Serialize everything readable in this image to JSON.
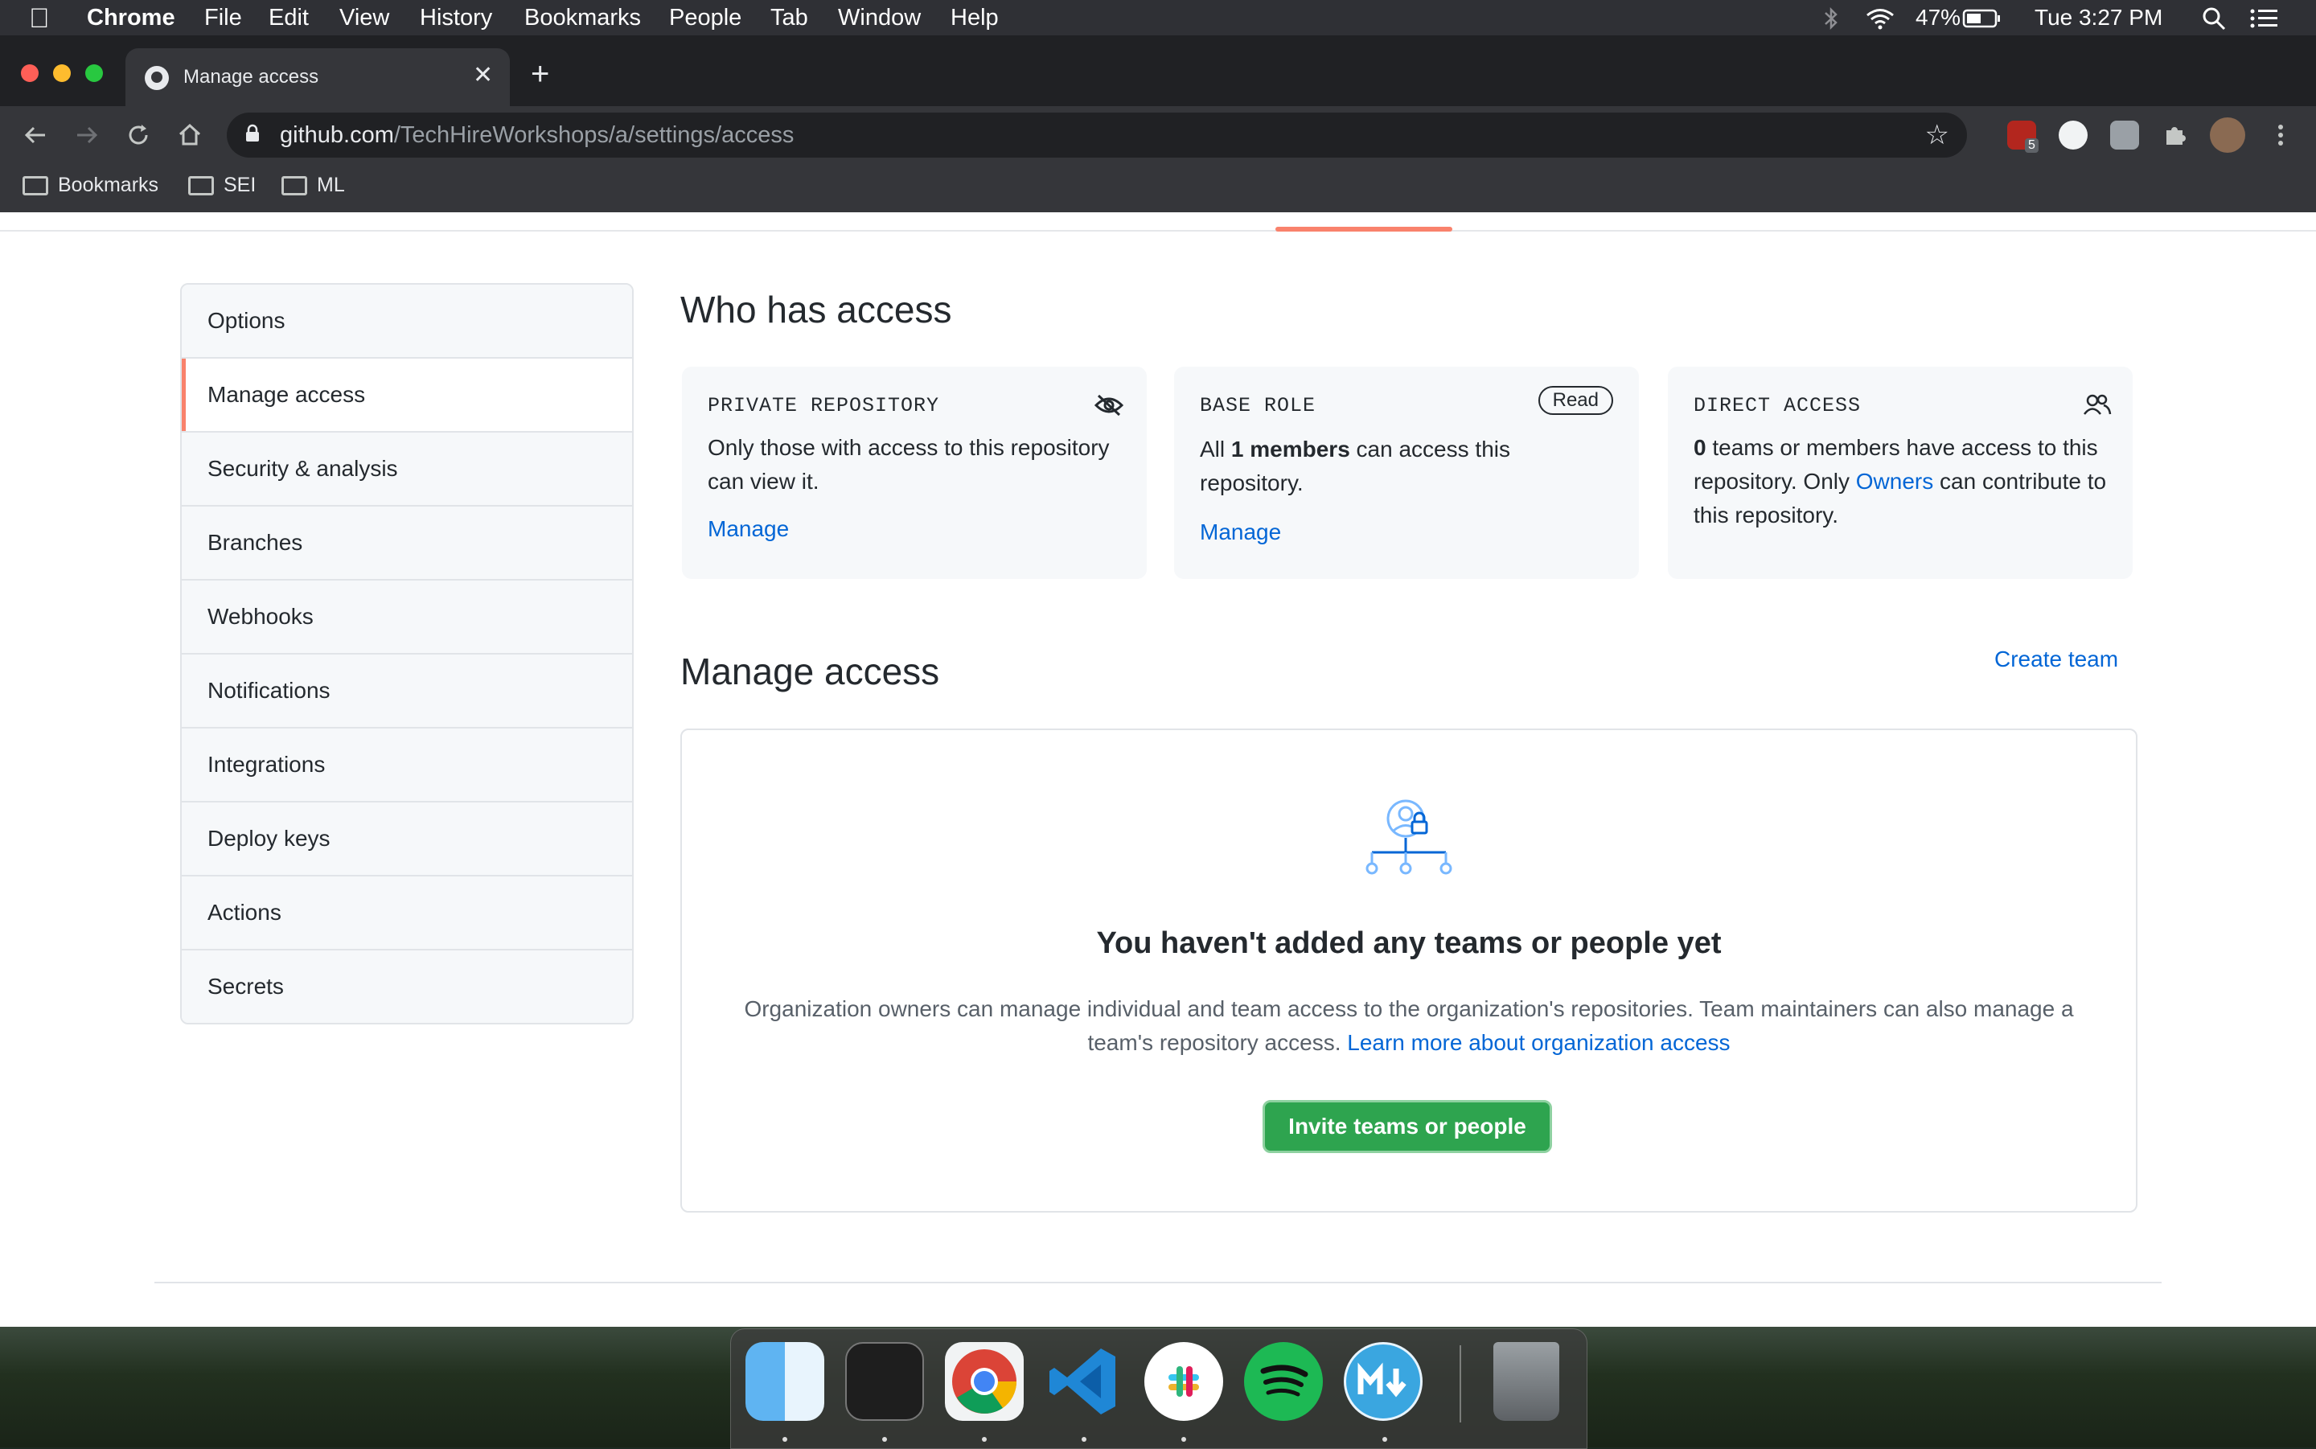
{
  "menubar": {
    "app": "Chrome",
    "items": [
      "File",
      "Edit",
      "View",
      "History",
      "Bookmarks",
      "People",
      "Tab",
      "Window",
      "Help"
    ],
    "battery": "47%",
    "clock": "Tue 3:27 PM"
  },
  "browser": {
    "tab_title": "Manage access",
    "url_host": "github.com",
    "url_path": "/TechHireWorkshops/a/settings/access",
    "extension_badge": "5",
    "bookmarks": [
      "Bookmarks",
      "SEI",
      "ML"
    ]
  },
  "sidebar": {
    "items": [
      {
        "label": "Options"
      },
      {
        "label": "Manage access"
      },
      {
        "label": "Security & analysis"
      },
      {
        "label": "Branches"
      },
      {
        "label": "Webhooks"
      },
      {
        "label": "Notifications"
      },
      {
        "label": "Integrations"
      },
      {
        "label": "Deploy keys"
      },
      {
        "label": "Actions"
      },
      {
        "label": "Secrets"
      }
    ],
    "active": "Manage access"
  },
  "who_has_access": {
    "title": "Who has access",
    "private_card": {
      "label": "PRIVATE REPOSITORY",
      "text": "Only those with access to this repository can view it.",
      "link": "Manage"
    },
    "base_role_card": {
      "label": "BASE ROLE",
      "badge": "Read",
      "text_pre": "All ",
      "count": "1 members",
      "text_post": " can access this repository.",
      "link": "Manage"
    },
    "direct_card": {
      "label": "DIRECT ACCESS",
      "count": "0",
      "text_a": " teams or members have access to this repository. Only ",
      "owners": "Owners",
      "text_b": " can contribute to this repository."
    }
  },
  "manage_access": {
    "title": "Manage access",
    "create_team": "Create team",
    "blank_title": "You haven't added any teams or people yet",
    "blank_desc": "Organization owners can manage individual and team access to the organization's repositories. Team maintainers can also manage a team's repository access. ",
    "learn_more": "Learn more about organization access",
    "invite_button": "Invite teams or people"
  },
  "dock": {
    "apps": [
      "Finder",
      "Terminal",
      "Google Chrome",
      "Visual Studio Code",
      "Slack",
      "Spotify",
      "Markdown",
      "Trash"
    ]
  },
  "colors": {
    "accent": "#f9826c",
    "link": "#0366d6",
    "primary_button": "#2ea44f"
  }
}
